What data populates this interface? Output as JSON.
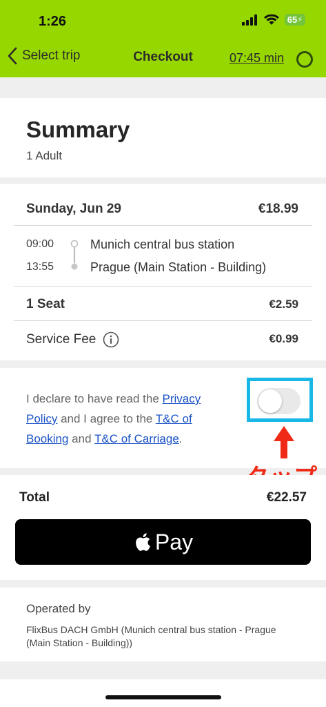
{
  "status_bar": {
    "time": "1:26",
    "battery": "65",
    "icons": [
      "signal-icon",
      "wifi-icon",
      "battery-icon"
    ]
  },
  "header": {
    "back_label": "Select trip",
    "title": "Checkout",
    "timer": "07:45 min"
  },
  "summary": {
    "title": "Summary",
    "passengers": "1 Adult"
  },
  "trip": {
    "date": "Sunday, Jun 29",
    "date_price": "€18.99",
    "departure_time": "09:00",
    "departure_stop": "Munich central bus station",
    "arrival_time": "13:55",
    "arrival_stop": "Prague (Main Station - Building)",
    "seat_label": "1 Seat",
    "seat_price": "€2.59",
    "fee_label": "Service Fee",
    "fee_price": "€0.99"
  },
  "declaration": {
    "text_1": "I declare to have read the",
    "privacy_link": "Privacy Policy",
    "text_2": "and I agree to the",
    "booking_link": "T&C of Booking",
    "text_3": "and",
    "carriage_link": "T&C of Carriage",
    "text_4": ".",
    "toggle_on": false
  },
  "annotation": {
    "tap_label": "タップ"
  },
  "payment": {
    "total_label": "Total",
    "total_price": "€22.57",
    "apple_pay_label": "Pay"
  },
  "operator": {
    "title": "Operated by",
    "text": "FlixBus DACH GmbH (Munich central bus station - Prague (Main Station - Building))"
  },
  "colors": {
    "header_green": "#97d700",
    "link_blue": "#1a52c4",
    "annotation_red": "#ef2a17",
    "annotation_cyan": "#19b7e6"
  }
}
